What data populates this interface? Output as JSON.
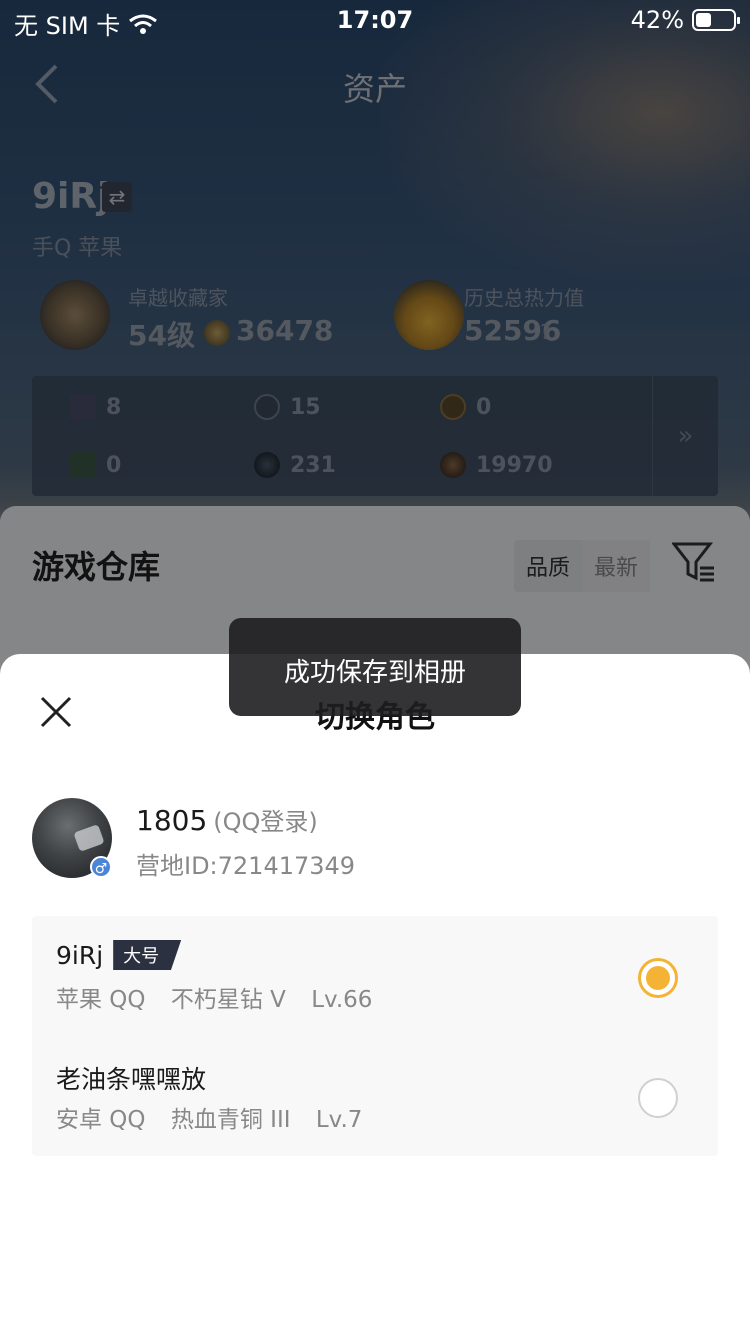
{
  "status_bar": {
    "carrier": "无 SIM 卡",
    "time": "17:07",
    "battery": "42%",
    "battery_level": 0.42
  },
  "nav": {
    "title": "资产"
  },
  "player": {
    "name": "9iRj",
    "platform": "手Q 苹果"
  },
  "badges": [
    {
      "title": "卓越收藏家",
      "level": "54级",
      "value": "36478"
    },
    {
      "title": "历史总热力值",
      "value": "52596",
      "help": "?"
    }
  ],
  "stats": [
    {
      "value": "8",
      "icon": "card-icon"
    },
    {
      "value": "15",
      "icon": "coin-icon"
    },
    {
      "value": "0",
      "icon": "medal-icon"
    },
    {
      "value": "0",
      "icon": "green-card-icon"
    },
    {
      "value": "231",
      "icon": "orb-icon"
    },
    {
      "value": "19970",
      "icon": "bronze-coin-icon"
    }
  ],
  "stats_more": "»",
  "warehouse": {
    "title": "游戏仓库",
    "sort_quality": "品质",
    "sort_newest": "最新"
  },
  "toast": {
    "text": "成功保存到相册"
  },
  "sheet": {
    "title": "切换角色",
    "account": {
      "name": "1805",
      "login": "(QQ登录)",
      "camp_id": "营地ID:721417349"
    },
    "roles": [
      {
        "name": "9iRj",
        "tag": "大号",
        "platform": "苹果 QQ",
        "rank": "不朽星钻 V",
        "level": "Lv.66",
        "selected": true
      },
      {
        "name": "老油条嘿嘿放",
        "tag": "",
        "platform": "安卓 QQ",
        "rank": "热血青铜 III",
        "level": "Lv.7",
        "selected": false
      }
    ]
  },
  "colors": {
    "accent": "#f5b335",
    "tag_bg": "#2b3140",
    "blue": "#3f7fcf"
  }
}
